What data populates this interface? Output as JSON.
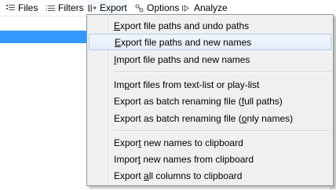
{
  "menubar": {
    "items": [
      {
        "label": "Files",
        "icon": "files-icon"
      },
      {
        "label": "Filters",
        "icon": "filters-icon"
      },
      {
        "label": "Export",
        "icon": "export-icon"
      },
      {
        "label": "Options",
        "icon": "options-icon"
      },
      {
        "label": "Analyze",
        "icon": "analyze-icon"
      }
    ]
  },
  "export_menu": {
    "groups": [
      [
        {
          "before": "",
          "mnemonic": "E",
          "after": "xport file paths and undo paths"
        },
        {
          "before": "",
          "mnemonic": "E",
          "after": "xport file paths and new names"
        },
        {
          "before": "",
          "mnemonic": "I",
          "after": "mport file paths and new names"
        }
      ],
      [
        {
          "before": "Im",
          "mnemonic": "p",
          "after": "ort files from text-list or play-list"
        },
        {
          "before": "Export as batch renaming file (",
          "mnemonic": "f",
          "after": "ull paths)"
        },
        {
          "before": "Export as batch renaming file (",
          "mnemonic": "o",
          "after": "nly names)"
        }
      ],
      [
        {
          "before": "Expor",
          "mnemonic": "t",
          "after": " new names to clipboard"
        },
        {
          "before": "Impor",
          "mnemonic": "t",
          "after": " new names from clipboard"
        },
        {
          "before": "Export ",
          "mnemonic": "a",
          "after": "ll columns to clipboard"
        }
      ]
    ],
    "hovered_label": "Export file paths and new names"
  },
  "colors": {
    "selection": "#3399ff",
    "menu_bg": "#f0f0f0",
    "hover_border": "#aecbf0"
  }
}
